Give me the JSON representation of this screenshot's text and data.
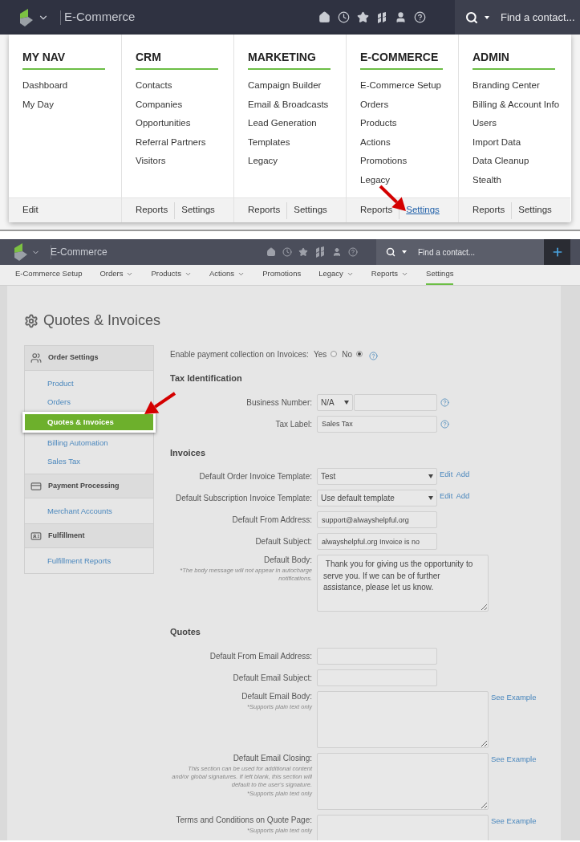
{
  "menu_screen": {
    "app_bar": {
      "title": "E-Commerce",
      "search_placeholder": "Find a contact..."
    },
    "mega_menu": {
      "columns": [
        {
          "heading": "MY NAV",
          "items": [
            "Dashboard",
            "My Day"
          ],
          "footer": [
            {
              "label": "Edit",
              "selected": false
            }
          ]
        },
        {
          "heading": "CRM",
          "items": [
            "Contacts",
            "Companies",
            "Opportunities",
            "Referral Partners",
            "Visitors"
          ],
          "footer": [
            {
              "label": "Reports",
              "selected": false
            },
            {
              "label": "Settings",
              "selected": false
            }
          ]
        },
        {
          "heading": "MARKETING",
          "items": [
            "Campaign Builder",
            "Email & Broadcasts",
            "Lead Generation",
            "Templates",
            "Legacy"
          ],
          "footer": [
            {
              "label": "Reports",
              "selected": false
            },
            {
              "label": "Settings",
              "selected": false
            }
          ]
        },
        {
          "heading": "E-COMMERCE",
          "items": [
            "E-Commerce Setup",
            "Orders",
            "Products",
            "Actions",
            "Promotions",
            "Legacy"
          ],
          "footer": [
            {
              "label": "Reports",
              "selected": false
            },
            {
              "label": "Settings",
              "selected": true
            }
          ]
        },
        {
          "heading": "ADMIN",
          "items": [
            "Branding Center",
            "Billing & Account Info",
            "Users",
            "Import Data",
            "Data Cleanup",
            "Stealth"
          ],
          "footer": [
            {
              "label": "Reports",
              "selected": false
            },
            {
              "label": "Settings",
              "selected": false
            }
          ]
        }
      ]
    }
  },
  "settings_screen": {
    "app_bar": {
      "title": "E-Commerce",
      "search_placeholder": "Find a contact..."
    },
    "tabs": [
      {
        "label": "E-Commerce Setup",
        "dropdown": false,
        "selected": false
      },
      {
        "label": "Orders",
        "dropdown": true,
        "selected": false
      },
      {
        "label": "Products",
        "dropdown": true,
        "selected": false
      },
      {
        "label": "Actions",
        "dropdown": true,
        "selected": false
      },
      {
        "label": "Promotions",
        "dropdown": false,
        "selected": false
      },
      {
        "label": "Legacy",
        "dropdown": true,
        "selected": false
      },
      {
        "label": "Reports",
        "dropdown": true,
        "selected": false
      },
      {
        "label": "Settings",
        "dropdown": false,
        "selected": true
      }
    ],
    "page_title": "Quotes & Invoices",
    "sidebar": {
      "sections": [
        {
          "title": "Order Settings",
          "items": [
            {
              "label": "Product",
              "selected": false
            },
            {
              "label": "Orders",
              "selected": false
            },
            {
              "label": "Quotes & Invoices",
              "selected": true
            },
            {
              "label": "Billing Automation",
              "selected": false
            },
            {
              "label": "Sales Tax",
              "selected": false
            }
          ]
        },
        {
          "title": "Payment Processing",
          "items": [
            {
              "label": "Merchant Accounts",
              "selected": false
            }
          ]
        },
        {
          "title": "Fulfillment",
          "items": [
            {
              "label": "Fulfillment Reports",
              "selected": false
            }
          ]
        }
      ]
    },
    "payment_collection": {
      "label": "Enable payment collection on Invoices:",
      "options": [
        {
          "label": "Yes",
          "selected": false
        },
        {
          "label": "No",
          "selected": true
        }
      ]
    },
    "sections": [
      {
        "title": "Tax Identification",
        "fields": [
          {
            "kind": "select_input",
            "label": "Business Number:",
            "value": "N/A",
            "help": true
          },
          {
            "kind": "text",
            "label": "Tax Label:",
            "value": "Sales Tax",
            "help": true
          }
        ]
      },
      {
        "title": "Invoices",
        "fields": [
          {
            "kind": "select",
            "label": "Default Order Invoice Template:",
            "value": "Test",
            "links": [
              "Edit",
              "Add"
            ]
          },
          {
            "kind": "select",
            "label": "Default Subscription Invoice Template:",
            "value": "Use default template",
            "links": [
              "Edit",
              "Add"
            ]
          },
          {
            "kind": "text",
            "label": "Default From Address:",
            "value": "support@alwayshelpful.org"
          },
          {
            "kind": "text",
            "label": "Default Subject:",
            "value": "alwayshelpful.org Invoice is no"
          },
          {
            "kind": "textarea",
            "label": "Default Body:",
            "notes": [
              "*The body message will not appear in autocharge notifications."
            ],
            "value": " Thank you for giving us the opportunity to serve you. If we can be of further assistance, please let us know."
          }
        ]
      },
      {
        "title": "Quotes",
        "fields": [
          {
            "kind": "text",
            "label": "Default From Email Address:"
          },
          {
            "kind": "text",
            "label": "Default Email Subject:"
          },
          {
            "kind": "textarea",
            "label": "Default Email Body:",
            "notes": [
              "*Supports plain text only"
            ],
            "links": [
              "See Example"
            ]
          },
          {
            "kind": "textarea",
            "label": "Default Email Closing:",
            "notes": [
              "This section can be used for additional content and/or global signatures. If left blank, this section will default to the user's signature.",
              "*Supports plain text only"
            ],
            "links": [
              "See Example"
            ]
          },
          {
            "kind": "textarea",
            "label": "Terms and Conditions on Quote Page:",
            "notes": [
              "*Supports plain text only"
            ],
            "links": [
              "See Example"
            ]
          }
        ]
      }
    ]
  }
}
